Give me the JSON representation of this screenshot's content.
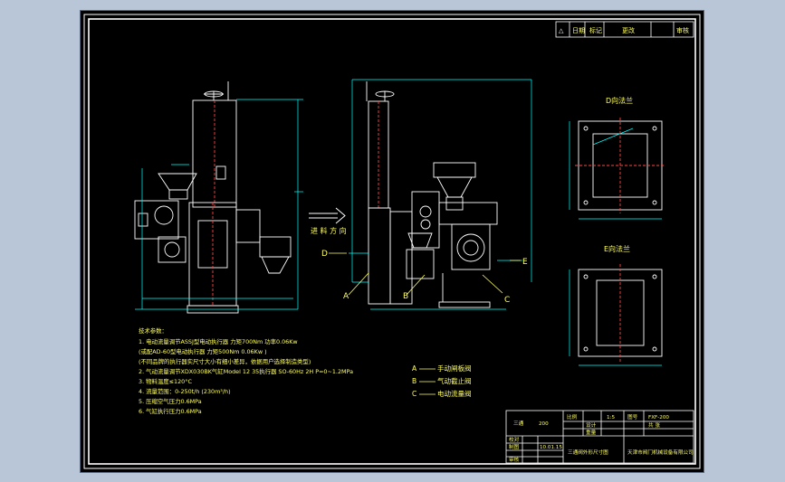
{
  "drawing": {
    "section_labels": {
      "d_flange": "D向法兰",
      "e_flange": "E向法兰",
      "inlet_direction": "进 料 方 向"
    },
    "callouts": {
      "a": "A",
      "b": "B",
      "c": "C",
      "d": "D",
      "e": "E"
    },
    "tech_notes": {
      "heading": "技术参数：",
      "lines": [
        "1. 电动流量调节ASSJ型电动执行器   力矩700Nm  功率0.06Kw",
        "  (或配AD-60型电动执行器 力矩500Nm  0.06Kw )",
        "  (不同品牌的执行器实尺寸大小有细小差异，依据用户选择制造类型)",
        "2. 气动流量调节XDX030BK气缸Model 12   35执行器   SO-60Hz  2H   P=0~1.2MPa",
        "3. 物料温度≤120°C",
        "4. 流量范围：0-250t/h (230m³/h)",
        "5. 压缩空气压力0.6MPa",
        "6. 气缸执行压力0.6MPa"
      ]
    },
    "legend": [
      {
        "key": "A",
        "label": "手动闸板阀"
      },
      {
        "key": "B",
        "label": "气动截止阀"
      },
      {
        "key": "C",
        "label": "电动流量阀"
      }
    ],
    "revision_table": {
      "headers": [
        "△",
        "日期",
        "标记",
        "更改",
        "审核"
      ]
    },
    "title_block": {
      "part_name": "三通",
      "size": "200",
      "scale_label": "比例",
      "scale_value": "1:5",
      "drawing_no_label": "图号",
      "drawing_no": "FXF-200",
      "design_label": "设计",
      "weight_label": "重量",
      "draw_label": "制图",
      "check_label": "校对",
      "approve_label": "审核",
      "date": "10.01.15",
      "sheet_label": "共  张",
      "title": "三通阀外形尺寸图",
      "company": "天津市阀门机械设备有限公司"
    }
  },
  "colors": {
    "sheet_bg": "#000000",
    "geometry": "#ffffff",
    "dimension": "#00ffff",
    "annotation": "#ffff66",
    "frame": "#b8c6d8"
  }
}
